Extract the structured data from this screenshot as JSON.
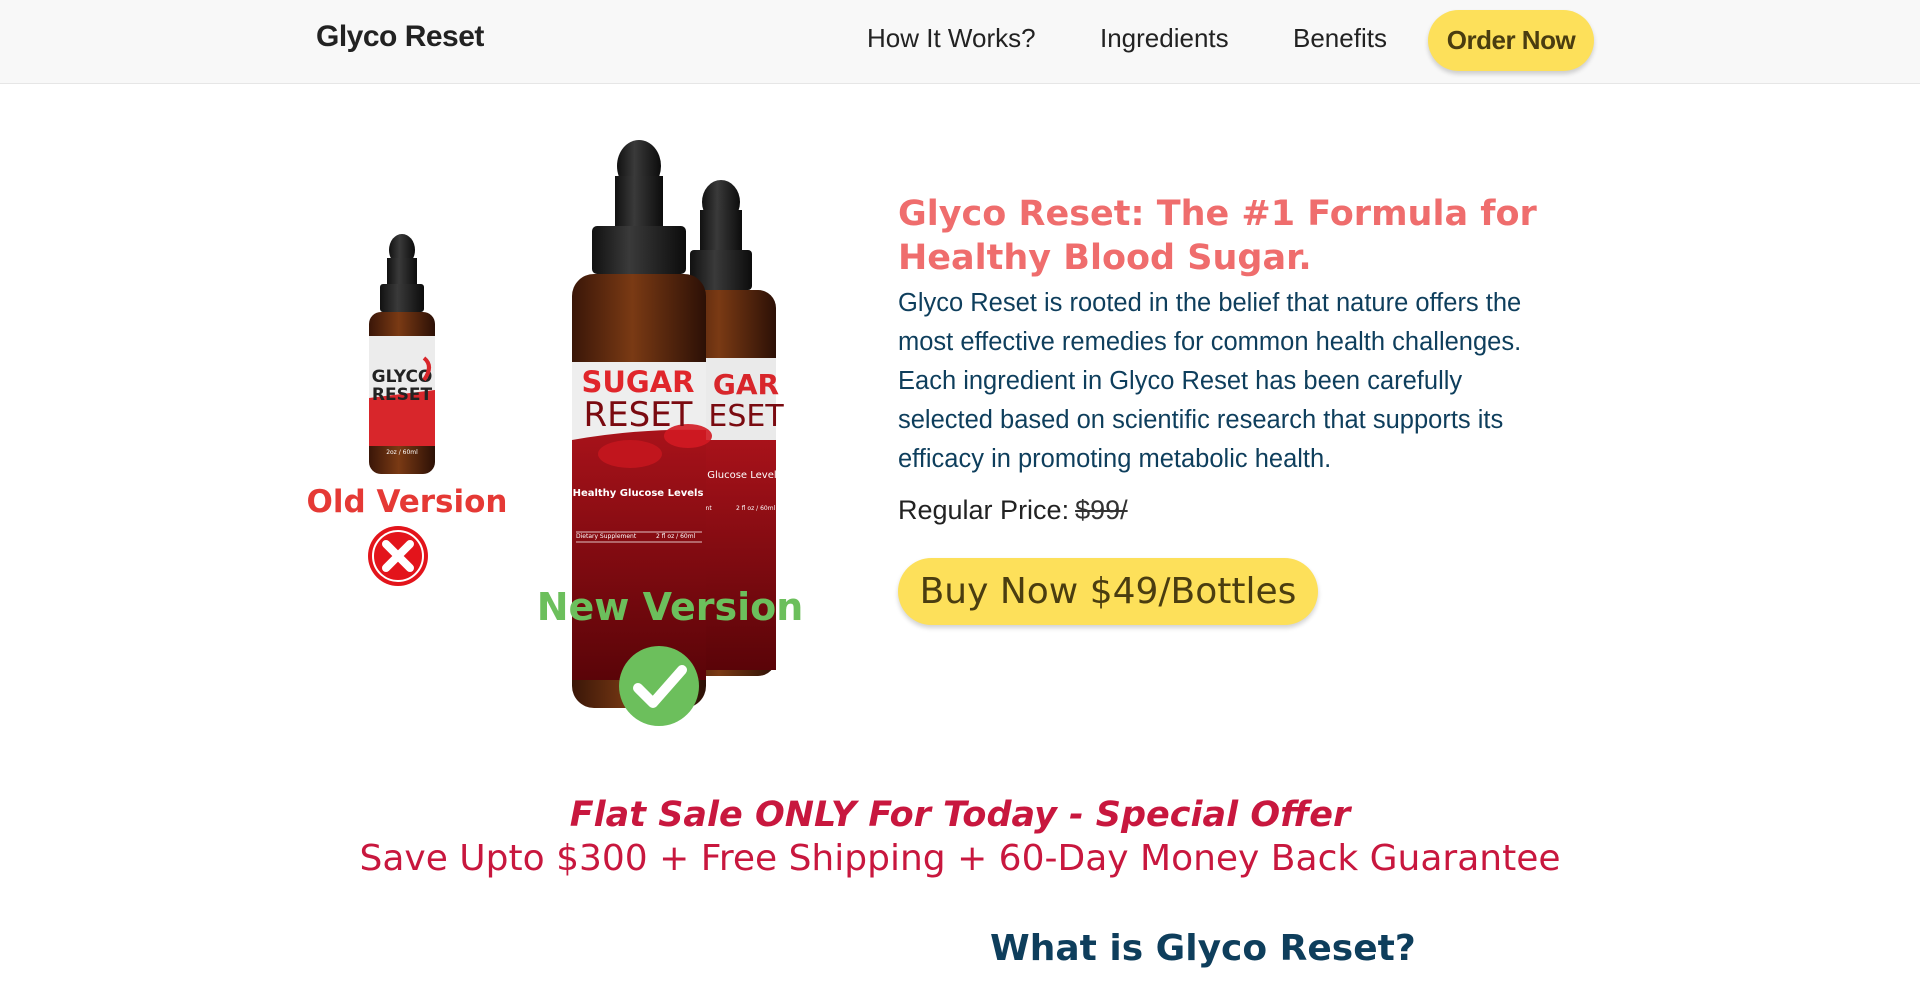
{
  "nav": {
    "brand": "Glyco Reset",
    "links": [
      "How It Works?",
      "Ingredients",
      "Benefits"
    ],
    "cta": "Order Now"
  },
  "product_image": {
    "old_label": "Old Version",
    "new_label": "New Version",
    "old_bottle_text": [
      "GLYCO",
      "RESET"
    ],
    "new_bottle_text": [
      "SUGAR",
      "RESET"
    ],
    "new_bottle_tagline": "Healthy Glucose Levels",
    "new_bottle_footer_left": "Dietary Supplement",
    "new_bottle_footer_right": "2 fl oz / 60ml",
    "back_bottle_text": [
      "GAR",
      "ESET"
    ],
    "back_bottle_tagline": "y Glucose Levels",
    "back_bottle_footer_left": "ment",
    "back_bottle_footer_right": "2 fl oz / 60ml",
    "old_bottle_size": "2oz / 60ml",
    "colors": {
      "old": "#e53935",
      "new": "#6cbf5c"
    }
  },
  "hero": {
    "title": "Glyco Reset: The #1 Formula for Healthy Blood Sugar.",
    "description": "Glyco Reset is rooted in the belief that nature offers the most effective remedies for common health challenges. Each ingredient in Glyco Reset has been carefully selected based on scientific research that supports its efficacy in promoting metabolic health.",
    "price_label": "Regular Price:",
    "price_old": "$99/",
    "buy_label": "Buy Now $49/Bottles"
  },
  "offer": {
    "title": "Flat Sale ONLY For Today - Special Offer",
    "subtitle": "Save Upto $300 + Free Shipping + 60-Day Money Back Guarantee"
  },
  "section": {
    "heading": "What is Glyco Reset?"
  },
  "colors": {
    "accent_yellow": "#fde05a",
    "title_coral": "#ef6d6d",
    "text_navy": "#0e3e5c",
    "offer_red": "#c8173e"
  }
}
